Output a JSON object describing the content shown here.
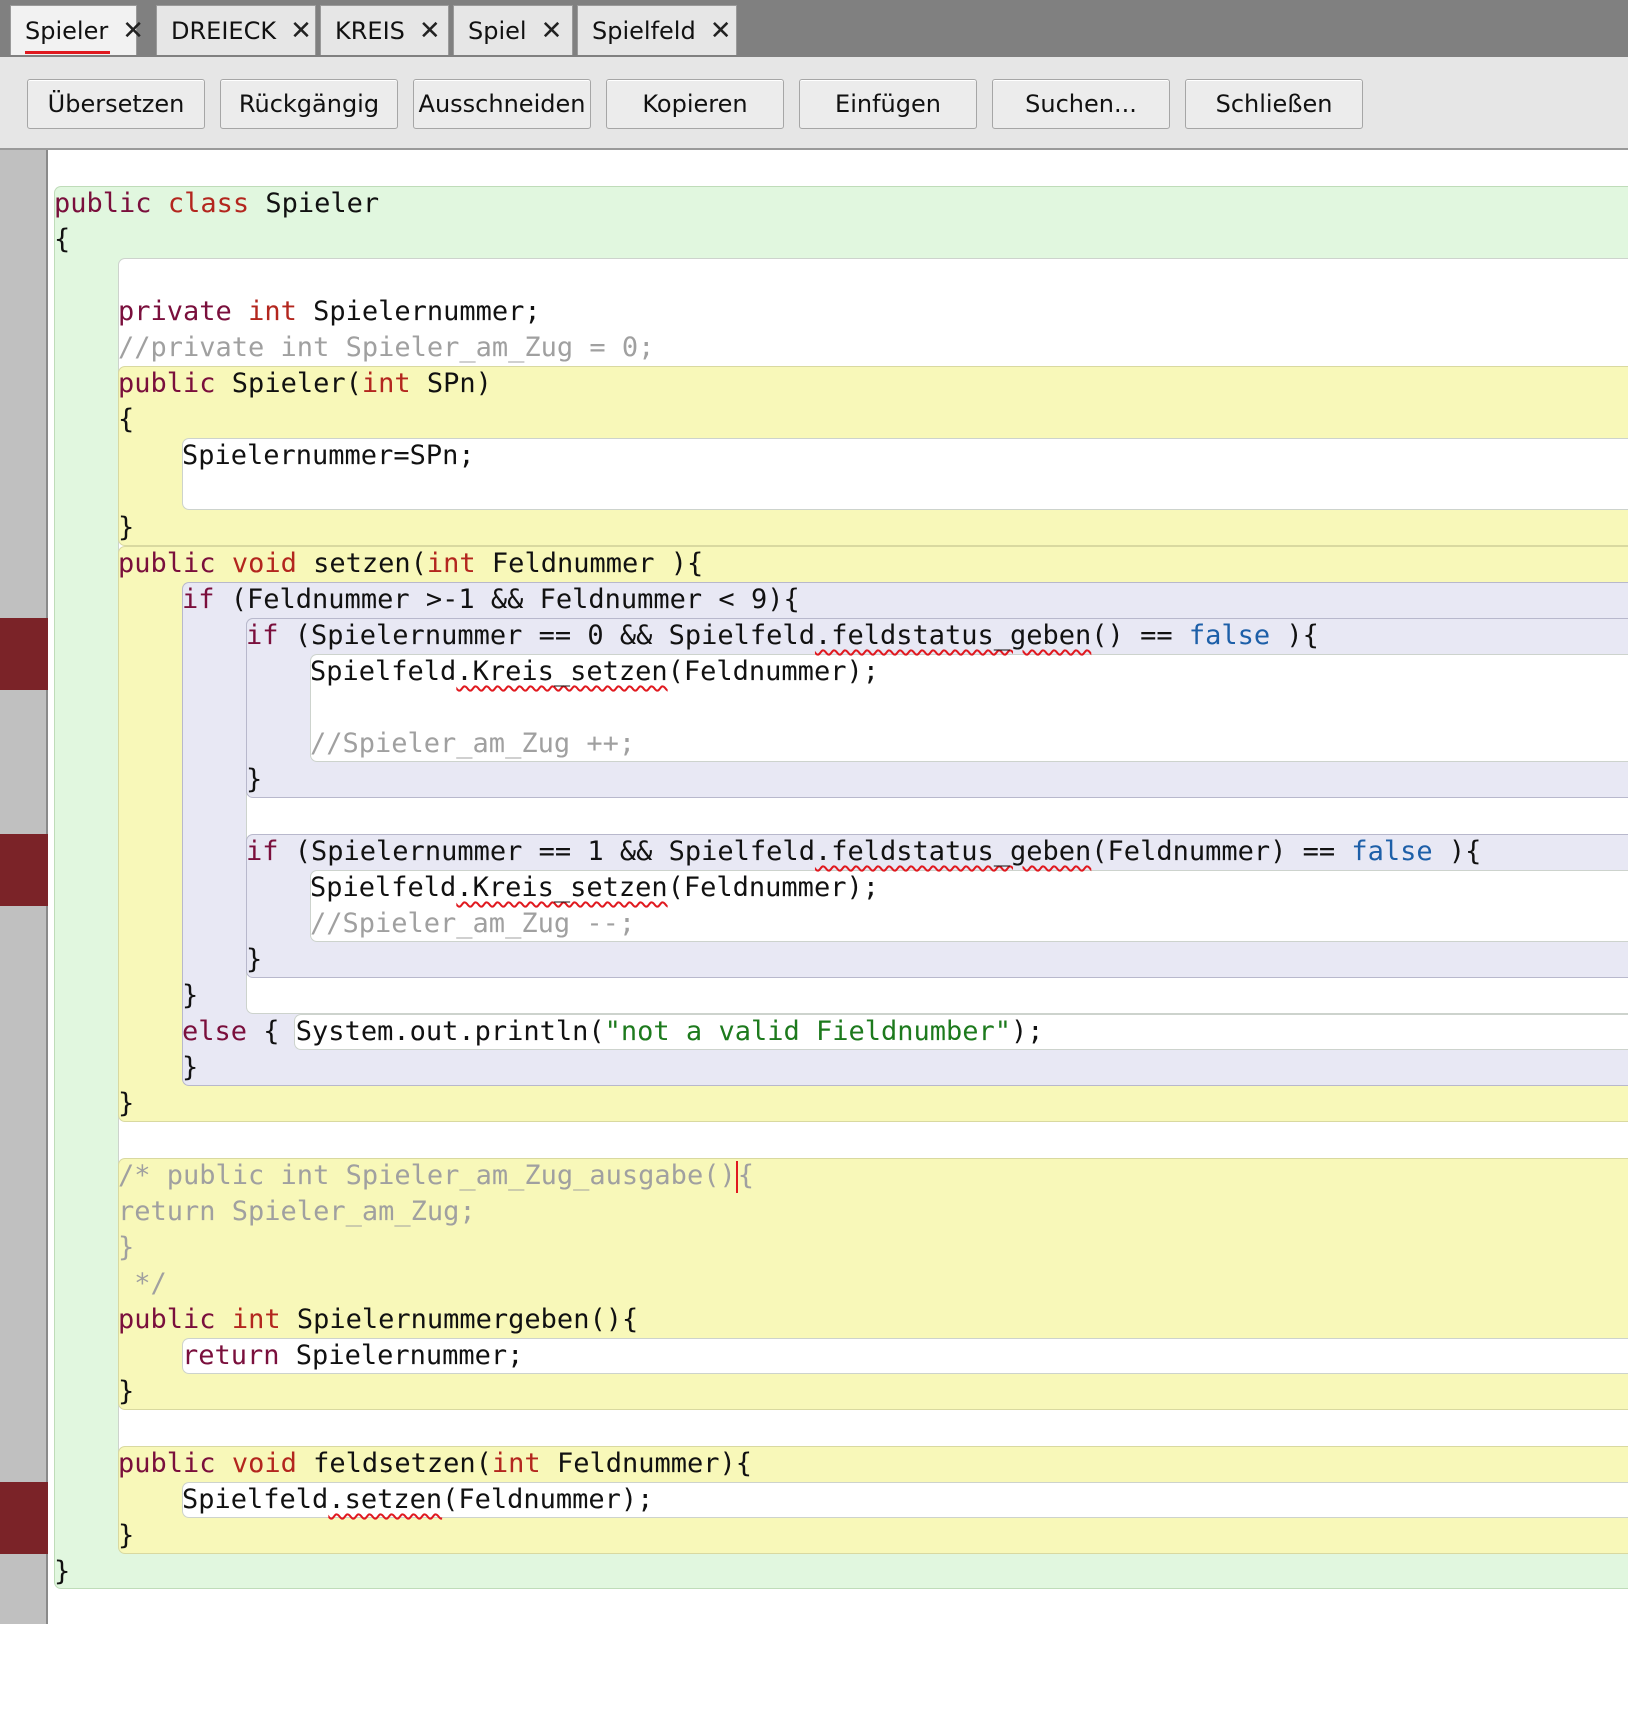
{
  "tabs": [
    {
      "label": "Spieler",
      "active": true
    },
    {
      "label": "DREIECK",
      "active": false
    },
    {
      "label": "KREIS",
      "active": false
    },
    {
      "label": "Spiel",
      "active": false
    },
    {
      "label": "Spielfeld",
      "active": false
    }
  ],
  "tab_close_glyph": "✕",
  "toolbar": {
    "compile": "Übersetzen",
    "undo": "Rückgängig",
    "cut": "Ausschneiden",
    "copy": "Kopieren",
    "paste": "Einfügen",
    "find": "Suchen...",
    "close": "Schließen"
  },
  "code": {
    "l01": {
      "a": "public",
      "b": " ",
      "c": "class",
      "d": " Spieler"
    },
    "l02": {
      "a": "{"
    },
    "l03": {
      "a": "private",
      "b": " ",
      "c": "int",
      "d": " Spielernummer;"
    },
    "l04": {
      "a": "//private int Spieler_am_Zug = 0;"
    },
    "l05": {
      "a": "public",
      "b": " Spieler(",
      "c": "int",
      "d": " SPn)"
    },
    "l06": {
      "a": "{"
    },
    "l07": {
      "a": "Spielernummer=SPn;"
    },
    "l08": {
      "a": "}"
    },
    "l09": {
      "a": "public",
      "b": " ",
      "c": "void",
      "d": " setzen(",
      "e": "int",
      "f": " Feldnummer ){"
    },
    "l10": {
      "a": "if",
      "b": " (Feldnummer >-1 && Feldnummer < 9){"
    },
    "l11": {
      "a": "if",
      "b": " (Spielernummer == 0 && Spielfeld",
      "c": ".feldstatus_geben",
      "d": "() == ",
      "e": "false",
      "f": " ){"
    },
    "l12": {
      "a": "Spielfeld",
      "b": ".Kreis_setzen",
      "c": "(Feldnummer);"
    },
    "l13": {
      "a": "//Spieler_am_Zug ++;"
    },
    "l14": {
      "a": "}"
    },
    "l15": {
      "a": "if",
      "b": " (Spielernummer == 1 && Spielfeld",
      "c": ".feldstatus_geben",
      "d": "(Feldnummer) == ",
      "e": "false",
      "f": " ){"
    },
    "l16": {
      "a": "Spielfeld",
      "b": ".Kreis_setzen",
      "c": "(Feldnummer);"
    },
    "l17": {
      "a": "//Spieler_am_Zug --;"
    },
    "l18": {
      "a": "}"
    },
    "l19": {
      "a": "}"
    },
    "l20": {
      "a": "else",
      "b": " { System.out.println(",
      "c": "\"not a valid Fieldnumber\"",
      "d": ");"
    },
    "l21": {
      "a": "}"
    },
    "l22": {
      "a": "}"
    },
    "l23": {
      "a": "/* public int Spieler_am_Zug_ausgabe()",
      "b": "{"
    },
    "l24": {
      "a": "return Spieler_am_Zug;"
    },
    "l25": {
      "a": "}"
    },
    "l26": {
      "a": " */"
    },
    "l27": {
      "a": "public",
      "b": " ",
      "c": "int",
      "d": " Spielernummergeben(){"
    },
    "l28": {
      "a": "return",
      "b": " Spielernummer;"
    },
    "l29": {
      "a": "}"
    },
    "l30": {
      "a": "public",
      "b": " ",
      "c": "void",
      "d": " feldsetzen(",
      "e": "int",
      "f": " Feldnummer){"
    },
    "l31": {
      "a": "Spielfeld",
      "b": ".setzen",
      "c": "(Feldnummer);"
    },
    "l32": {
      "a": "}"
    },
    "l33": {
      "a": "}"
    }
  },
  "colors": {
    "class_scope": "#e1f7df",
    "method_scope": "#f8f8b9",
    "if_scope": "#e8e8f4",
    "breakpoint": "#7b2328",
    "keyword": "#7a0f3c",
    "type": "#b3261e",
    "boolean": "#1d5fa8",
    "string": "#1d7a1d",
    "comment": "#a0a0a0"
  }
}
